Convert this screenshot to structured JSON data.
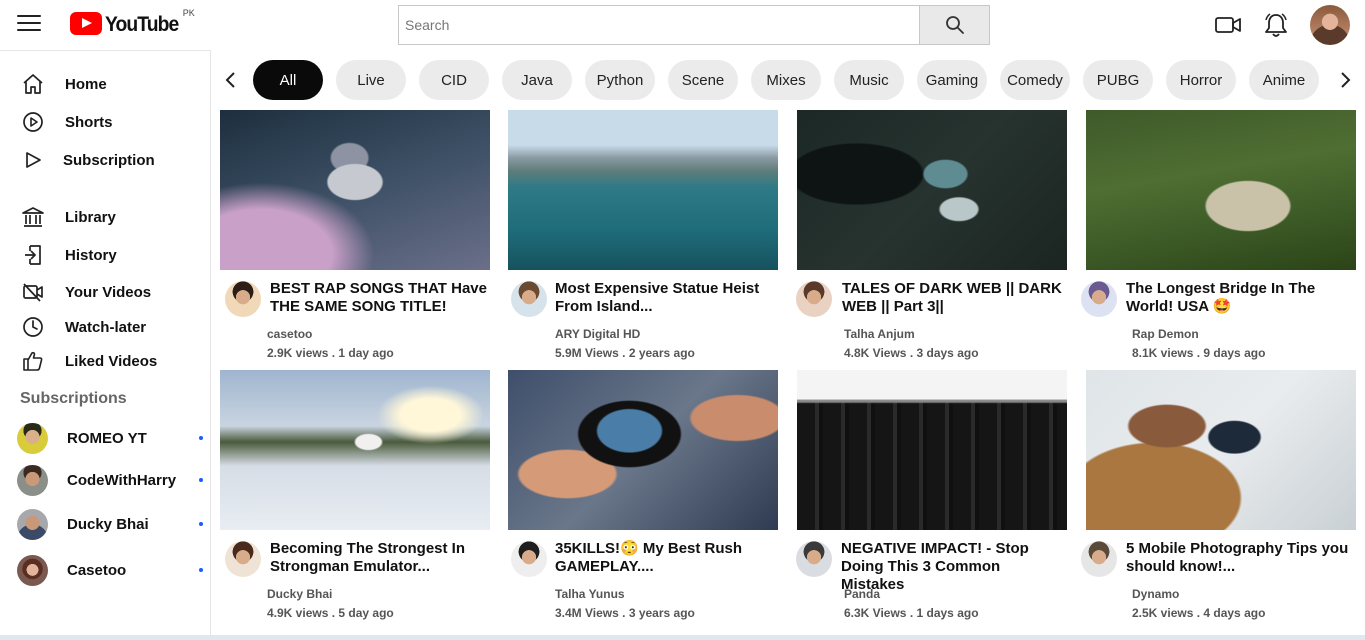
{
  "header": {
    "logo_text": "YouTube",
    "region": "PK",
    "search_placeholder": "Search"
  },
  "sidebar": {
    "items": [
      {
        "label": "Home",
        "icon": "home-icon"
      },
      {
        "label": "Shorts",
        "icon": "shorts-icon"
      },
      {
        "label": "Subscription",
        "icon": "subscription-icon"
      },
      {
        "label": "Library",
        "icon": "library-icon"
      },
      {
        "label": "History",
        "icon": "history-icon"
      },
      {
        "label": "Your Videos",
        "icon": "your-videos-icon"
      },
      {
        "label": "Watch-later",
        "icon": "clock-icon"
      },
      {
        "label": "Liked Videos",
        "icon": "thumbs-up-icon"
      }
    ],
    "subscriptions_title": "Subscriptions",
    "subscriptions": [
      {
        "name": "ROMEO YT"
      },
      {
        "name": "CodeWithHarry"
      },
      {
        "name": "Ducky Bhai"
      },
      {
        "name": "Casetoo"
      }
    ]
  },
  "chips": [
    "All",
    "Live",
    "CID",
    "Java",
    "Python",
    "Scene",
    "Mixes",
    "Music",
    "Gaming",
    "Comedy",
    "PUBG",
    "Horror",
    "Anime"
  ],
  "videos": [
    {
      "title": "BEST RAP SONGS THAT Have THE SAME SONG TITLE!",
      "channel": "casetoo",
      "views": "2.9K views . ",
      "age": "1 day ago"
    },
    {
      "title": "Most Expensive Statue Heist From Island...",
      "channel": "ARY Digital HD",
      "views": "5.9M Views . ",
      "age": "2 years ago"
    },
    {
      "title": "TALES OF DARK WEB || DARK WEB || Part 3||",
      "channel": "Talha Anjum",
      "views": "4.8K Views . ",
      "age": "3 days ago"
    },
    {
      "title": "The Longest Bridge In The World! USA 🤩",
      "channel": "Rap Demon",
      "views": "8.1K views . ",
      "age": "9 days ago"
    },
    {
      "title": "Becoming The Strongest In Strongman Emulator...",
      "channel": "Ducky Bhai",
      "views": "4.9K views . ",
      "age": "5 day ago"
    },
    {
      "title": "35KILLS!😳 My Best Rush GAMEPLAY....",
      "channel": "Talha Yunus",
      "views": "3.4M Views . ",
      "age": "3 years ago"
    },
    {
      "title": "NEGATIVE IMPACT! - Stop Doing This 3 Common Mistakes",
      "channel": "Panda",
      "views": "6.3K Views . ",
      "age": "1 days ago"
    },
    {
      "title": "5 Mobile Photography Tips you should know!...",
      "channel": "Dynamo",
      "views": "2.5K views . ",
      "age": "4 days ago"
    }
  ],
  "colors": {
    "brand_red": "#ff0000",
    "chip_active": "#0a0a0a",
    "chip_bg": "#ebebeb",
    "sub_dot": "#1a5cff"
  }
}
